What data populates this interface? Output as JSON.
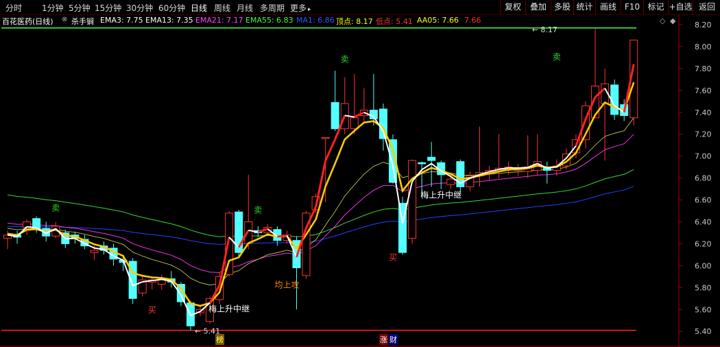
{
  "toolbar": {
    "periods": [
      "分时",
      "1分钟",
      "5分钟",
      "15分钟",
      "30分钟",
      "60分钟",
      "日线",
      "周线",
      "月线",
      "多周期",
      "更多"
    ],
    "active_period": "日线",
    "more_arrow": "▸",
    "right_buttons": [
      "复权",
      "叠加",
      "多股",
      "统计",
      "画线",
      "F10",
      "标记",
      "+自选",
      "返回"
    ]
  },
  "info": {
    "stock": "百花医药(日线)",
    "indicator": "杀手锏",
    "items": [
      {
        "text": "EMA3: 7.75",
        "color": "#ffffff"
      },
      {
        "text": "EMA13: 7.35",
        "color": "#ffffff"
      },
      {
        "text": "EMA21: 7.17",
        "color": "#ff44ff"
      },
      {
        "text": "EMA55: 6.83",
        "color": "#44ff44"
      },
      {
        "text": "MA1: 6.86",
        "color": "#3355ff"
      },
      {
        "text": "顶点: 8.17",
        "color": "#ffff00"
      },
      {
        "text": "低点: 5.41",
        "color": "#ff3333"
      },
      {
        "text": "AA05: 7.66",
        "color": "#ffff00"
      },
      {
        "text": "7.66",
        "color": "#ff3333"
      }
    ]
  },
  "chart_data": {
    "type": "candlestick",
    "ylim": [
      5.35,
      8.25
    ],
    "yticks": [
      "8.20",
      "8.00",
      "7.80",
      "7.60",
      "7.40",
      "7.20",
      "7.00",
      "6.80",
      "6.60",
      "6.40",
      "6.20",
      "6.00",
      "5.80",
      "5.60",
      "5.40"
    ],
    "candles": [
      {
        "o": 6.25,
        "c": 6.28,
        "h": 6.32,
        "l": 6.15
      },
      {
        "o": 6.28,
        "c": 6.26,
        "h": 6.32,
        "l": 6.2
      },
      {
        "o": 6.35,
        "c": 6.4,
        "h": 6.42,
        "l": 6.28
      },
      {
        "o": 6.43,
        "c": 6.34,
        "h": 6.45,
        "l": 6.3
      },
      {
        "o": 6.34,
        "c": 6.27,
        "h": 6.4,
        "l": 6.22
      },
      {
        "o": 6.27,
        "c": 6.36,
        "h": 6.4,
        "l": 6.25
      },
      {
        "o": 6.3,
        "c": 6.2,
        "h": 6.33,
        "l": 6.16
      },
      {
        "o": 6.28,
        "c": 6.25,
        "h": 6.31,
        "l": 6.2
      },
      {
        "o": 6.24,
        "c": 6.18,
        "h": 6.28,
        "l": 6.15
      },
      {
        "o": 6.12,
        "c": 6.14,
        "h": 6.18,
        "l": 6.05
      },
      {
        "o": 6.18,
        "c": 6.14,
        "h": 6.22,
        "l": 6.1
      },
      {
        "o": 6.16,
        "c": 6.06,
        "h": 6.2,
        "l": 6.0
      },
      {
        "o": 6.05,
        "c": 6.03,
        "h": 6.1,
        "l": 5.95
      },
      {
        "o": 6.04,
        "c": 5.7,
        "h": 6.07,
        "l": 5.65
      },
      {
        "o": 5.75,
        "c": 5.87,
        "h": 5.92,
        "l": 5.72
      },
      {
        "o": 5.85,
        "c": 5.87,
        "h": 5.9,
        "l": 5.78
      },
      {
        "o": 5.83,
        "c": 5.88,
        "h": 5.92,
        "l": 5.78
      },
      {
        "o": 5.88,
        "c": 5.85,
        "h": 5.95,
        "l": 5.8
      },
      {
        "o": 5.83,
        "c": 5.67,
        "h": 5.85,
        "l": 5.63
      },
      {
        "o": 5.66,
        "c": 5.45,
        "h": 5.68,
        "l": 5.41
      },
      {
        "o": 5.57,
        "c": 5.6,
        "h": 5.63,
        "l": 5.54
      },
      {
        "o": 5.49,
        "c": 5.7,
        "h": 5.72,
        "l": 5.47
      },
      {
        "o": 5.69,
        "c": 5.9,
        "h": 5.94,
        "l": 5.65
      },
      {
        "o": 5.92,
        "c": 6.48,
        "h": 6.5,
        "l": 5.9
      },
      {
        "o": 6.49,
        "c": 6.12,
        "h": 6.51,
        "l": 6.08
      },
      {
        "o": 6.2,
        "c": 6.4,
        "h": 6.83,
        "l": 6.15
      },
      {
        "o": 6.32,
        "c": 6.3,
        "h": 6.36,
        "l": 6.26
      },
      {
        "o": 6.3,
        "c": 6.35,
        "h": 6.38,
        "l": 6.28
      },
      {
        "o": 6.33,
        "c": 6.23,
        "h": 6.36,
        "l": 6.18
      },
      {
        "o": 6.23,
        "c": 6.28,
        "h": 6.32,
        "l": 6.2
      },
      {
        "o": 6.23,
        "c": 5.98,
        "h": 6.27,
        "l": 5.6
      },
      {
        "o": 5.91,
        "c": 6.48,
        "h": 6.5,
        "l": 5.88
      },
      {
        "o": 6.51,
        "c": 6.63,
        "h": 6.66,
        "l": 6.48
      },
      {
        "o": 7.16,
        "c": 7.17,
        "h": 7.17,
        "l": 6.58
      },
      {
        "o": 7.49,
        "c": 7.25,
        "h": 7.78,
        "l": 7.23
      },
      {
        "o": 7.25,
        "c": 7.48,
        "h": 7.72,
        "l": 7.2
      },
      {
        "o": 7.25,
        "c": 7.35,
        "h": 7.75,
        "l": 7.2
      },
      {
        "o": 7.37,
        "c": 7.42,
        "h": 7.62,
        "l": 7.3
      },
      {
        "o": 7.42,
        "c": 7.34,
        "h": 7.75,
        "l": 7.28
      },
      {
        "o": 7.43,
        "c": 7.16,
        "h": 7.48,
        "l": 7.05
      },
      {
        "o": 7.15,
        "c": 6.76,
        "h": 7.2,
        "l": 6.75
      },
      {
        "o": 6.57,
        "c": 6.12,
        "h": 6.63,
        "l": 6.1
      },
      {
        "o": 6.25,
        "c": 6.96,
        "h": 6.97,
        "l": 6.2
      },
      {
        "o": 6.94,
        "c": 6.93,
        "h": 6.95,
        "l": 6.63
      },
      {
        "o": 6.99,
        "c": 6.96,
        "h": 7.13,
        "l": 6.72
      },
      {
        "o": 6.94,
        "c": 6.83,
        "h": 6.96,
        "l": 6.7
      },
      {
        "o": 6.74,
        "c": 6.79,
        "h": 6.85,
        "l": 6.7
      },
      {
        "o": 6.95,
        "c": 6.72,
        "h": 6.97,
        "l": 6.67
      },
      {
        "o": 6.72,
        "c": 6.82,
        "h": 6.86,
        "l": 6.68
      },
      {
        "o": 6.82,
        "c": 6.85,
        "h": 7.27,
        "l": 6.72
      },
      {
        "o": 6.84,
        "c": 6.87,
        "h": 6.91,
        "l": 6.78
      },
      {
        "o": 6.86,
        "c": 6.89,
        "h": 7.2,
        "l": 6.8
      },
      {
        "o": 6.88,
        "c": 6.9,
        "h": 6.95,
        "l": 6.83
      },
      {
        "o": 6.87,
        "c": 6.89,
        "h": 6.93,
        "l": 6.82
      },
      {
        "o": 6.86,
        "c": 6.9,
        "h": 7.19,
        "l": 6.8
      },
      {
        "o": 6.87,
        "c": 6.95,
        "h": 7.2,
        "l": 6.83
      },
      {
        "o": 6.9,
        "c": 6.87,
        "h": 6.95,
        "l": 6.75
      },
      {
        "o": 6.87,
        "c": 6.91,
        "h": 6.97,
        "l": 6.82
      },
      {
        "o": 6.91,
        "c": 7.02,
        "h": 7.07,
        "l": 6.88
      },
      {
        "o": 7.03,
        "c": 7.15,
        "h": 7.2,
        "l": 6.98
      },
      {
        "o": 7.15,
        "c": 7.46,
        "h": 7.5,
        "l": 7.07
      },
      {
        "o": 7.35,
        "c": 7.64,
        "h": 8.17,
        "l": 7.35
      },
      {
        "o": 7.48,
        "c": 7.66,
        "h": 7.8,
        "l": 6.96
      },
      {
        "o": 7.65,
        "c": 7.38,
        "h": 7.7,
        "l": 7.33
      },
      {
        "o": 7.47,
        "c": 7.37,
        "h": 7.52,
        "l": 7.32
      },
      {
        "o": 7.35,
        "c": 8.06,
        "h": 8.06,
        "l": 7.28
      }
    ],
    "series": [
      {
        "name": "EMA3",
        "color": "#ffffff"
      },
      {
        "name": "EMA13",
        "color": "#ffffff"
      },
      {
        "name": "EMA21",
        "color": "#ff44ff"
      },
      {
        "name": "EMA55",
        "color": "#44ff44"
      },
      {
        "name": "MA1",
        "color": "#3355ff"
      },
      {
        "name": "AA05",
        "color": "#ffff00"
      }
    ],
    "top_line": 8.17,
    "bottom_line": 5.41,
    "annotations": [
      {
        "text": "卖",
        "i": 5,
        "y": 6.5,
        "color": "#22dd22"
      },
      {
        "text": "买",
        "i": 15,
        "y": 5.57,
        "color": "#ff3333"
      },
      {
        "text": "梅上升中继",
        "i": 23,
        "y": 5.58,
        "color": "#ffffff"
      },
      {
        "text": "卖",
        "i": 26,
        "y": 6.48,
        "color": "#22dd22"
      },
      {
        "text": "均上攻",
        "i": 29,
        "y": 5.8,
        "color": "#ff8800"
      },
      {
        "text": "卖",
        "i": 35,
        "y": 7.86,
        "color": "#22dd22"
      },
      {
        "text": "买",
        "i": 40,
        "y": 6.05,
        "color": "#ff3333"
      },
      {
        "text": "梅上升中继",
        "i": 45,
        "y": 6.62,
        "color": "#ffffff"
      },
      {
        "text": "卖",
        "i": 57,
        "y": 7.88,
        "color": "#22dd22"
      }
    ],
    "price_marks": [
      {
        "text": "8.17",
        "i": 54,
        "y": 8.17
      },
      {
        "text": "5.41",
        "i": 19,
        "y": 5.41
      }
    ],
    "bottom_markers": [
      {
        "text": "榜",
        "i": 22,
        "bg": "#7a5800",
        "fg": "#ffff66"
      },
      {
        "text": "涨",
        "i": 39,
        "bg": "#7a0000",
        "fg": "#ffffff"
      },
      {
        "text": "财",
        "i": 40,
        "bg": "#00007a",
        "fg": "#ffffff"
      }
    ]
  }
}
